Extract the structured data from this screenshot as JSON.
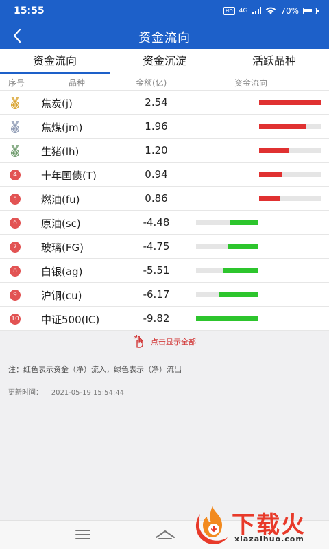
{
  "status_bar": {
    "time": "15:55",
    "hd": "HD",
    "network": "4G",
    "battery_percent": "70%",
    "battery_level": 0.7
  },
  "header": {
    "title": "资金流向"
  },
  "tabs": [
    {
      "label": "资金流向",
      "active": true
    },
    {
      "label": "资金沉淀",
      "active": false
    },
    {
      "label": "活跃品种",
      "active": false
    }
  ],
  "columns": {
    "rank": "序号",
    "name": "品种",
    "amount": "金额(亿)",
    "flow": "资金流向"
  },
  "rows": [
    {
      "rank": "1",
      "name": "焦炭(j)",
      "amount": "2.54",
      "value": 2.54
    },
    {
      "rank": "2",
      "name": "焦煤(jm)",
      "amount": "1.96",
      "value": 1.96
    },
    {
      "rank": "3",
      "name": "生猪(lh)",
      "amount": "1.20",
      "value": 1.2
    },
    {
      "rank": "4",
      "name": "十年国债(T)",
      "amount": "0.94",
      "value": 0.94
    },
    {
      "rank": "5",
      "name": "燃油(fu)",
      "amount": "0.86",
      "value": 0.86
    },
    {
      "rank": "6",
      "name": "原油(sc)",
      "amount": "-4.48",
      "value": -4.48
    },
    {
      "rank": "7",
      "name": "玻璃(FG)",
      "amount": "-4.75",
      "value": -4.75
    },
    {
      "rank": "8",
      "name": "白银(ag)",
      "amount": "-5.51",
      "value": -5.51
    },
    {
      "rank": "9",
      "name": "沪铜(cu)",
      "amount": "-6.17",
      "value": -6.17
    },
    {
      "rank": "10",
      "name": "中证500(IC)",
      "amount": "-9.82",
      "value": -9.82
    }
  ],
  "show_all_label": "点击显示全部",
  "note": "注：红色表示资金（净）流入，绿色表示（净）流出",
  "updated": {
    "label": "更新时间：",
    "value": "2021-05-19 15:54:44"
  },
  "watermark": {
    "text": "下载火",
    "sub": "xiazaihuo.com"
  },
  "colors": {
    "primary": "#1d60c9",
    "inflow": "#e03131",
    "outflow": "#2dc52d",
    "gold": "#d9a431",
    "silver": "#8f9bb5",
    "bronze": "#6f9b6d",
    "rank_circle": "#e25353"
  }
}
